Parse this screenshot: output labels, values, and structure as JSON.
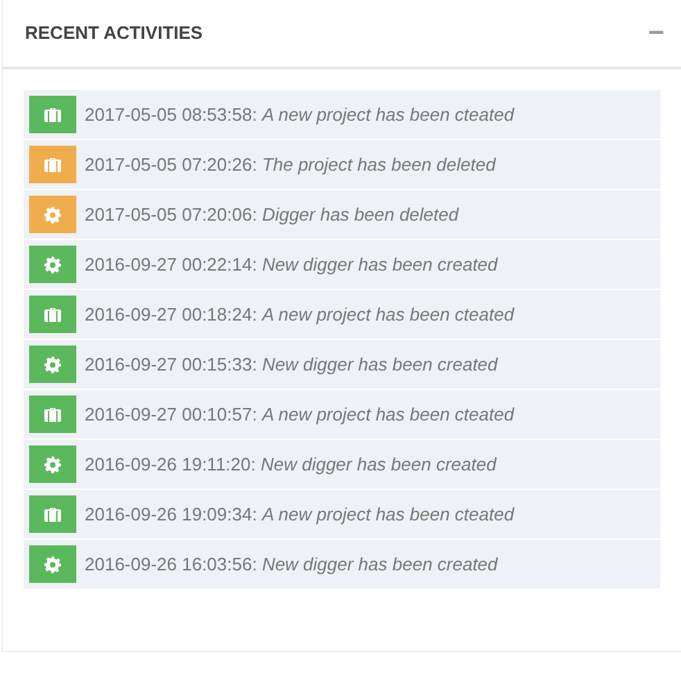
{
  "panel": {
    "title": "RECENT ACTIVITIES",
    "collapse_icon": "−"
  },
  "activities": [
    {
      "kind": "project",
      "color": "#5cb85c",
      "text": "2017-05-05 08:53:58: *A new project has been cteated*"
    },
    {
      "kind": "project",
      "color": "#f0ad4e",
      "text": "2017-05-05 07:20:26: *The project has been deleted*"
    },
    {
      "kind": "digger",
      "color": "#f0ad4e",
      "text": "2017-05-05 07:20:06: *Digger has been deleted*"
    },
    {
      "kind": "digger",
      "color": "#5cb85c",
      "text": "2016-09-27 00:22:14: *New digger has been created*"
    },
    {
      "kind": "project",
      "color": "#5cb85c",
      "text": "2016-09-27 00:18:24: *A new project has been cteated*"
    },
    {
      "kind": "digger",
      "color": "#5cb85c",
      "text": "2016-09-27 00:15:33: *New digger has been created*"
    },
    {
      "kind": "project",
      "color": "#5cb85c",
      "text": "2016-09-27 00:10:57: *A new project has been cteated*"
    },
    {
      "kind": "digger",
      "color": "#5cb85c",
      "text": "2016-09-26 19:11:20: *New digger has been created*"
    },
    {
      "kind": "project",
      "color": "#5cb85c",
      "text": "2016-09-26 19:09:34: *A new project has been cteated*"
    },
    {
      "kind": "digger",
      "color": "#5cb85c",
      "text": "2016-09-26 16:03:56: *New digger has been created*"
    }
  ]
}
